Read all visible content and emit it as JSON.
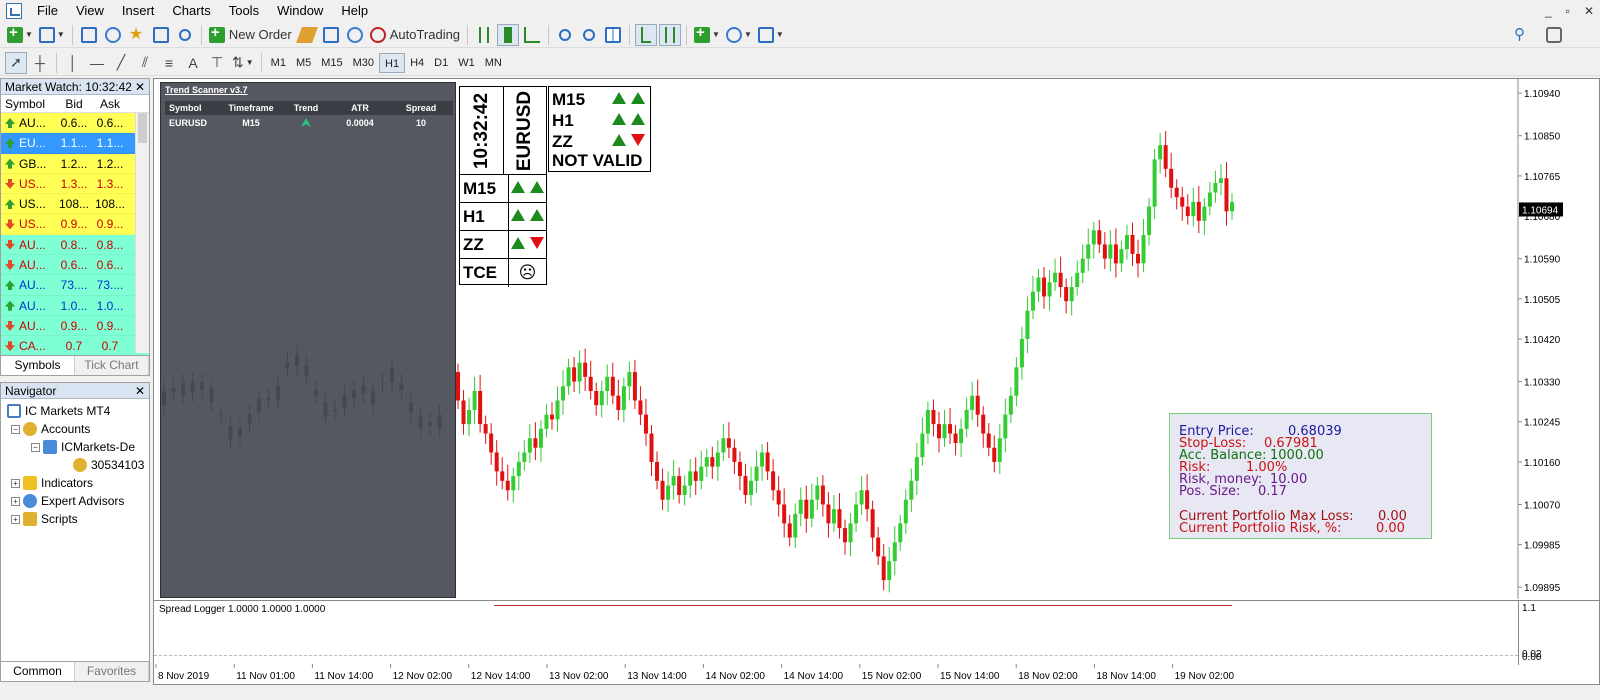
{
  "menu": {
    "items": [
      "File",
      "View",
      "Insert",
      "Charts",
      "Tools",
      "Window",
      "Help"
    ],
    "window_controls": [
      "_",
      "▫",
      "✕"
    ]
  },
  "toolbar": {
    "new_order_label": "New Order",
    "autotrading_label": "AutoTrading",
    "timeframes": [
      "M1",
      "M5",
      "M15",
      "M30",
      "H1",
      "H4",
      "D1",
      "W1",
      "MN"
    ],
    "active_timeframe": "H1",
    "text_tool": "A"
  },
  "market_watch": {
    "title": "Market Watch: 10:32:42",
    "columns": [
      "Symbol",
      "Bid",
      "Ask"
    ],
    "rows": [
      {
        "symbol": "AU...",
        "bid": "0.6...",
        "ask": "0.6...",
        "dir": "up",
        "bg": "#ffff55",
        "color": "#000000"
      },
      {
        "symbol": "EU...",
        "bid": "1.1...",
        "ask": "1.1...",
        "dir": "up",
        "bg": "#3399ff",
        "color": "#ffffff"
      },
      {
        "symbol": "GB...",
        "bid": "1.2...",
        "ask": "1.2...",
        "dir": "up",
        "bg": "#ffff55",
        "color": "#000000"
      },
      {
        "symbol": "US...",
        "bid": "1.3...",
        "ask": "1.3...",
        "dir": "down",
        "bg": "#ffff55",
        "color": "#cc0000"
      },
      {
        "symbol": "US...",
        "bid": "108...",
        "ask": "108...",
        "dir": "up",
        "bg": "#ffff55",
        "color": "#000000"
      },
      {
        "symbol": "US...",
        "bid": "0.9...",
        "ask": "0.9...",
        "dir": "down",
        "bg": "#ffff55",
        "color": "#cc0000"
      },
      {
        "symbol": "AU...",
        "bid": "0.8...",
        "ask": "0.8...",
        "dir": "down",
        "bg": "#7fffd4",
        "color": "#cc0000"
      },
      {
        "symbol": "AU...",
        "bid": "0.6...",
        "ask": "0.6...",
        "dir": "down",
        "bg": "#7fffd4",
        "color": "#cc0000"
      },
      {
        "symbol": "AU...",
        "bid": "73....",
        "ask": "73....",
        "dir": "up",
        "bg": "#7fffd4",
        "color": "#0033cc"
      },
      {
        "symbol": "AU...",
        "bid": "1.0...",
        "ask": "1.0...",
        "dir": "up",
        "bg": "#7fffd4",
        "color": "#0033cc"
      },
      {
        "symbol": "AU...",
        "bid": "0.9...",
        "ask": "0.9...",
        "dir": "down",
        "bg": "#7fffd4",
        "color": "#cc0000"
      },
      {
        "symbol": "CA...",
        "bid": "0.7",
        "ask": "0.7",
        "dir": "down",
        "bg": "#7fffd4",
        "color": "#cc0000"
      }
    ],
    "tabs": [
      "Symbols",
      "Tick Chart"
    ],
    "active_tab": "Symbols"
  },
  "navigator": {
    "title": "Navigator",
    "root": "IC Markets MT4",
    "accounts": "Accounts",
    "account_server": "ICMarkets-De",
    "account_number": "30534103",
    "indicators": "Indicators",
    "expert_advisors": "Expert Advisors",
    "scripts": "Scripts",
    "tabs": [
      "Common",
      "Favorites"
    ],
    "active_tab": "Common"
  },
  "trend_scanner": {
    "title": "Trend Scanner v3.7",
    "columns": [
      "Symbol",
      "Timeframe",
      "Trend",
      "ATR",
      "Spread"
    ],
    "row": {
      "symbol": "EURUSD",
      "timeframe": "M15",
      "trend": "up",
      "atr": "0.0004",
      "spread": "10"
    }
  },
  "indicator_box": {
    "time": "10:32:42",
    "symbol": "EURUSD",
    "rows": [
      {
        "label": "M15",
        "arrows": [
          "up",
          "up"
        ]
      },
      {
        "label": "H1",
        "arrows": [
          "up",
          "up"
        ]
      },
      {
        "label": "ZZ",
        "arrows": [
          "up",
          "down"
        ]
      },
      {
        "label": "TCE",
        "arrows": [
          "frown"
        ]
      }
    ]
  },
  "signal_box": {
    "rows": [
      {
        "label": "M15",
        "arrows": [
          "up",
          "up"
        ]
      },
      {
        "label": "H1",
        "arrows": [
          "up",
          "up"
        ]
      },
      {
        "label": "ZZ",
        "arrows": [
          "up",
          "down"
        ]
      }
    ],
    "status": "NOT VALID"
  },
  "risk_panel": {
    "entry_label": "Entry Price:",
    "entry_value": "0.68039",
    "sl_label": "Stop-Loss:",
    "sl_value": "0.67981",
    "balance_label": "Acc. Balance:",
    "balance_value": "1000.00",
    "risk_label": "Risk:",
    "risk_value": "1.00%",
    "risk_money_label": "Risk, money:",
    "risk_money_value": "10.00",
    "pos_size_label": "Pos. Size:",
    "pos_size_value": "0.17",
    "max_loss_label": "Current Portfolio Max Loss:",
    "max_loss_value": "0.00",
    "portfolio_risk_label": "Current Portfolio Risk, %:",
    "portfolio_risk_value": "0.00",
    "colors": {
      "blue": "#1a1aa0",
      "red": "#c81414",
      "green": "#107010",
      "purple": "#6a1a8a",
      "darkred": "#a01010"
    }
  },
  "sub_indicator": {
    "label": "Spread Logger  1.0000 1.0000 1.0000",
    "scale_top": "1.1",
    "scale_bottom": "0.00",
    "scale_bottom2": "0.02"
  },
  "chart_data": {
    "type": "candlestick",
    "symbol": "EURUSD",
    "timeframe": "H1",
    "price_ticks": [
      "1.10940",
      "1.10850",
      "1.10765",
      "1.10680",
      "1.10590",
      "1.10505",
      "1.10420",
      "1.10330",
      "1.10245",
      "1.10160",
      "1.10070",
      "1.09985",
      "1.09895"
    ],
    "price_tick_values": [
      1.1094,
      1.1085,
      1.10765,
      1.1068,
      1.1059,
      1.10505,
      1.1042,
      1.1033,
      1.10245,
      1.1016,
      1.1007,
      1.09985,
      1.09895
    ],
    "current_price": "1.10694",
    "current_price_value": 1.10694,
    "ylim": [
      1.0987,
      1.1097
    ],
    "time_labels": [
      "8 Nov 2019",
      "11 Nov 01:00",
      "11 Nov 14:00",
      "12 Nov 02:00",
      "12 Nov 14:00",
      "13 Nov 02:00",
      "13 Nov 14:00",
      "14 Nov 02:00",
      "14 Nov 14:00",
      "15 Nov 02:00",
      "15 Nov 14:00",
      "18 Nov 02:00",
      "18 Nov 14:00",
      "19 Nov 02:00"
    ],
    "colors": {
      "bull": "#33cc33",
      "bear": "#e01010"
    },
    "close": [
      1.1029,
      1.1024,
      1.1027,
      1.1031,
      1.1024,
      1.1022,
      1.1018,
      1.1014,
      1.1012,
      1.101,
      1.1013,
      1.1016,
      1.1018,
      1.1021,
      1.1019,
      1.1023,
      1.1026,
      1.1025,
      1.1029,
      1.1032,
      1.1036,
      1.1033,
      1.1037,
      1.1034,
      1.1031,
      1.1028,
      1.1031,
      1.1034,
      1.103,
      1.1027,
      1.1032,
      1.1035,
      1.1029,
      1.1026,
      1.1022,
      1.1016,
      1.1012,
      1.1008,
      1.1011,
      1.1013,
      1.1009,
      1.1011,
      1.1014,
      1.1012,
      1.1015,
      1.1017,
      1.1015,
      1.1018,
      1.1021,
      1.1019,
      1.1016,
      1.1013,
      1.1009,
      1.1012,
      1.1015,
      1.1018,
      1.1014,
      1.101,
      1.1007,
      1.1003,
      1.1,
      1.1005,
      1.1008,
      1.1004,
      1.1008,
      1.1011,
      1.1007,
      1.1003,
      1.1006,
      1.1002,
      1.0999,
      1.1003,
      1.1007,
      1.101,
      1.1006,
      1.1,
      1.0996,
      1.0991,
      1.0995,
      1.0999,
      1.1003,
      1.1008,
      1.1012,
      1.1017,
      1.1022,
      1.1027,
      1.1024,
      1.1021,
      1.1024,
      1.1022,
      1.102,
      1.1023,
      1.1027,
      1.103,
      1.1026,
      1.1022,
      1.1019,
      1.1016,
      1.1021,
      1.1026,
      1.103,
      1.1036,
      1.1042,
      1.1048,
      1.1052,
      1.1055,
      1.1051,
      1.1054,
      1.1056,
      1.1053,
      1.105,
      1.1053,
      1.1056,
      1.1059,
      1.1062,
      1.1065,
      1.1062,
      1.1059,
      1.1062,
      1.1058,
      1.1061,
      1.1064,
      1.106,
      1.1058,
      1.1064,
      1.107,
      1.108,
      1.1083,
      1.1078,
      1.1074,
      1.1072,
      1.107,
      1.1068,
      1.1071,
      1.1067,
      1.107,
      1.1073,
      1.1075,
      1.1076,
      1.1069,
      1.1071
    ]
  }
}
